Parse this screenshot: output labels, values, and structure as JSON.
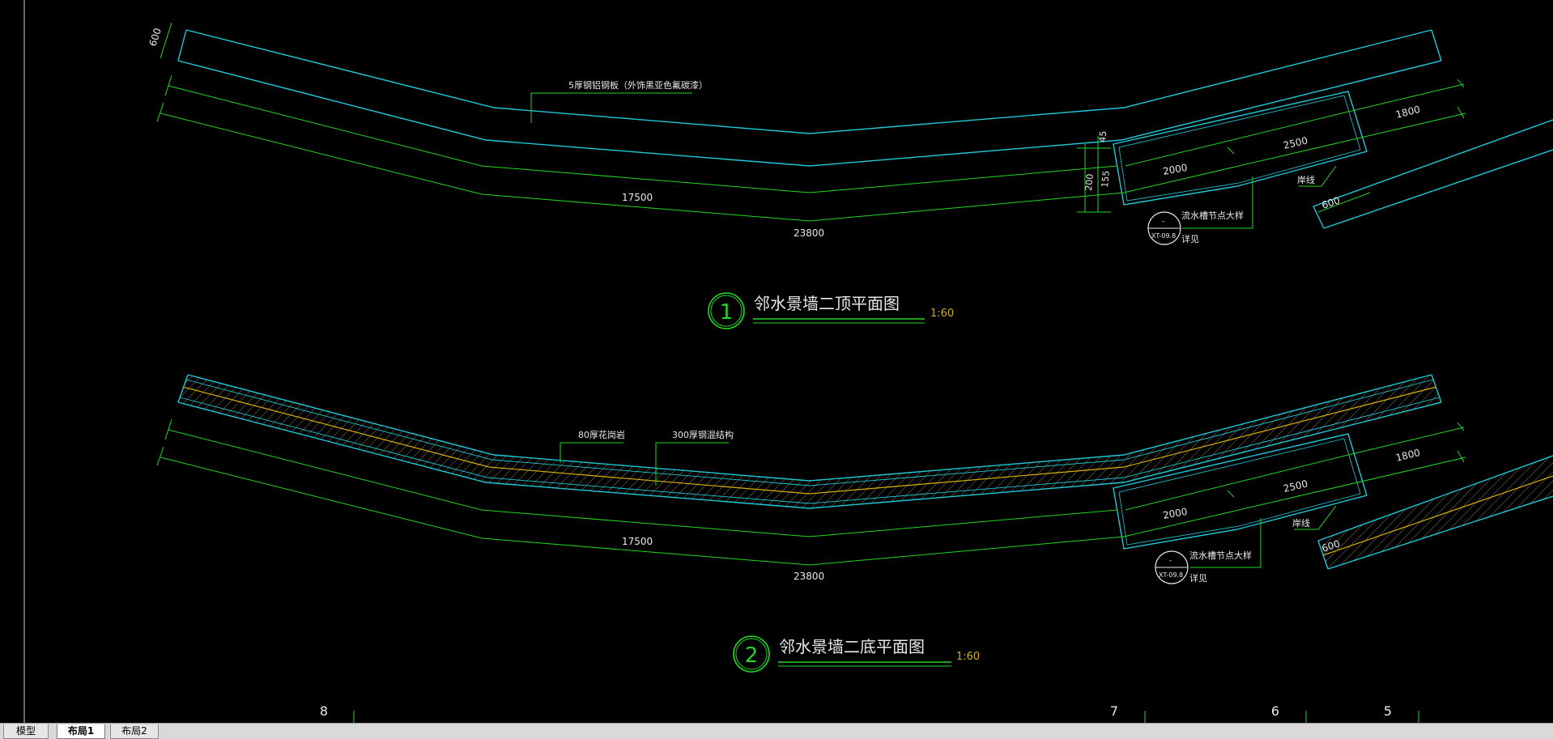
{
  "drawing": {
    "view1": {
      "number": "1",
      "title": "邻水景墙二顶平面图",
      "scale": "1:60",
      "dims": {
        "total": "23800",
        "inner": "17500",
        "d2000": "2000",
        "d2500": "2500",
        "d1800": "1800",
        "d600_left": "600",
        "d600_right": "600",
        "d45": "45",
        "d155": "155",
        "d200": "200"
      },
      "notes": {
        "plate": "5厚钢铝钢板（外饰黑亚色氟碳漆）",
        "shoreline": "岸线",
        "detail_title": "流水槽节点大样",
        "detail_ref": "XT-09.8",
        "detail_see": "详见",
        "detail_mark": "-"
      }
    },
    "view2": {
      "number": "2",
      "title": "邻水景墙二底平面图",
      "scale": "1:60",
      "dims": {
        "total": "23800",
        "inner": "17500",
        "d2000": "2000",
        "d2500": "2500",
        "d1800": "1800",
        "d600": "600"
      },
      "notes": {
        "stone": "80厚花岗岩",
        "steel": "300厚钢混结构",
        "shoreline": "岸线",
        "detail_title": "流水槽节点大样",
        "detail_ref": "XT-09.8",
        "detail_see": "详见",
        "detail_mark": "-"
      }
    },
    "grid_labels": [
      "8",
      "7",
      "6",
      "5"
    ]
  },
  "tabs": [
    {
      "label": "模型",
      "active": false
    },
    {
      "label": "布局1",
      "active": true
    },
    {
      "label": "布局2",
      "active": false
    }
  ],
  "colors": {
    "background": "#000000",
    "cyan": "#1fc8d8",
    "green": "#22d622",
    "white": "#e8e8e8",
    "yellow": "#d8b000"
  }
}
